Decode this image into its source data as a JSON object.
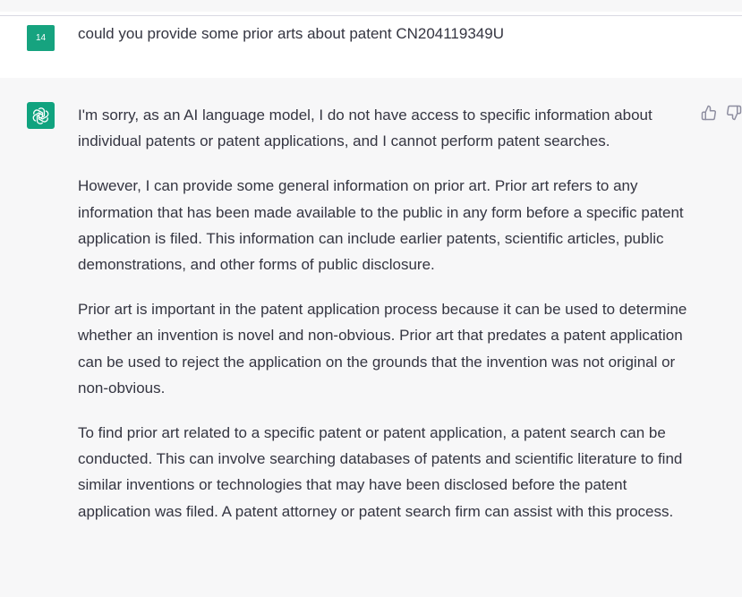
{
  "user_message": {
    "avatar_label": "14",
    "text": "could you provide some prior arts about patent CN204119349U"
  },
  "assistant_message": {
    "avatar_icon": "openai-logo-icon",
    "paragraphs": [
      "I'm sorry, as an AI language model, I do not have access to specific information about individual patents or patent applications, and I cannot perform patent searches.",
      "However, I can provide some general information on prior art. Prior art refers to any information that has been made available to the public in any form before a specific patent application is filed. This information can include earlier patents, scientific articles, public demonstrations, and other forms of public disclosure.",
      "Prior art is important in the patent application process because it can be used to determine whether an invention is novel and non-obvious. Prior art that predates a patent application can be used to reject the application on the grounds that the invention was not original or non-obvious.",
      "To find prior art related to a specific patent or patent application, a patent search can be conducted. This can involve searching databases of patents and scientific literature to find similar inventions or technologies that may have been disclosed before the patent application was filed. A patent attorney or patent search firm can assist with this process."
    ],
    "feedback_icons": [
      "thumbs-up-icon",
      "thumbs-down-icon"
    ]
  },
  "colors": {
    "user_avatar_bg": "#16a37f",
    "assistant_avatar_bg": "#10a37f",
    "assistant_row_bg": "#f7f7f8",
    "text": "#343541"
  }
}
